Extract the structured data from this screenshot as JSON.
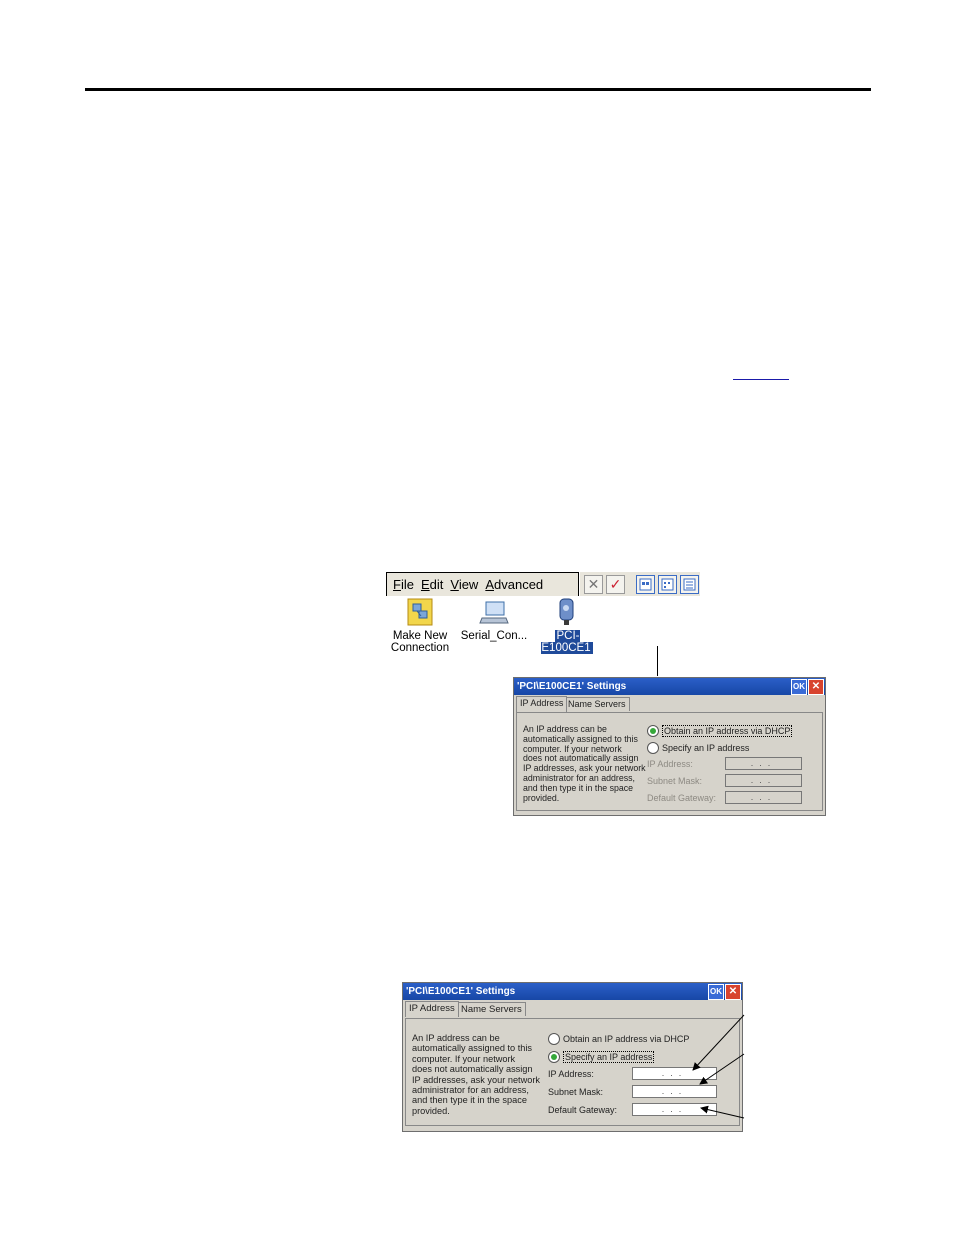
{
  "menubar": {
    "items": [
      "File",
      "Edit",
      "View",
      "Advanced"
    ]
  },
  "toolbar": {
    "icons": [
      "delete-icon",
      "properties-icon",
      "large-icons-view-icon",
      "small-icons-view-icon",
      "details-view-icon"
    ]
  },
  "connections": [
    {
      "label_line1": "Make New",
      "label_line2": "Connection"
    },
    {
      "label": "Serial_Con..."
    },
    {
      "label": "PCI-E100CE1"
    }
  ],
  "dialog1": {
    "title": "'PCI\\E100CE1' Settings",
    "ok": "OK",
    "close": "✕",
    "tab_ip": "IP Address",
    "tab_ns": "Name Servers",
    "desc": [
      "An IP address can be",
      "automatically assigned to this",
      "computer.  If your network",
      "does not automatically assign",
      "IP addresses, ask your network",
      "administrator for an address,",
      "and then type it in the space",
      "provided."
    ],
    "radio_dhcp": "Obtain an IP address via DHCP",
    "radio_specify": "Specify an IP address",
    "label_ip": "IP Address:",
    "label_mask": "Subnet Mask:",
    "label_gateway": "Default Gateway:",
    "ip_value": "...",
    "mask_value": "...",
    "gateway_value": "...",
    "selected": "dhcp"
  },
  "dialog2": {
    "title": "'PCI\\E100CE1' Settings",
    "ok": "OK",
    "close": "✕",
    "tab_ip": "IP Address",
    "tab_ns": "Name Servers",
    "desc": [
      "An IP address can be",
      "automatically assigned to this",
      "computer.  If your network",
      "does not automatically assign",
      "IP addresses, ask your network",
      "administrator for an address,",
      "and then type it in the space",
      "provided."
    ],
    "radio_dhcp": "Obtain an IP address via DHCP",
    "radio_specify": "Specify an IP address",
    "label_ip": "IP Address:",
    "label_mask": "Subnet Mask:",
    "label_gateway": "Default Gateway:",
    "ip_value": "...",
    "mask_value": "...",
    "gateway_value": "...",
    "selected": "specify"
  },
  "colors": {
    "titlebar": "#1747a6",
    "dialog_bg": "#d6d3cb",
    "selection": "#1f4a9a",
    "radio_on": "#36a83a"
  }
}
